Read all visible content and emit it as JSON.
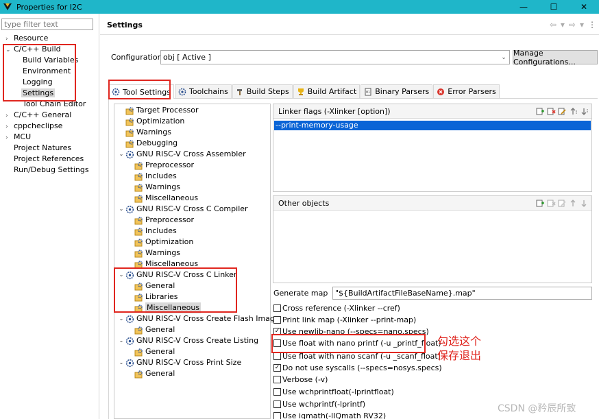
{
  "window": {
    "title": "Properties for I2C",
    "min": "—",
    "max": "☐",
    "close": "✕"
  },
  "filter": {
    "placeholder": "type filter text"
  },
  "nav": {
    "resource": "Resource",
    "cc_build": "C/C++ Build",
    "build_variables": "Build Variables",
    "environment": "Environment",
    "logging": "Logging",
    "settings": "Settings",
    "tool_chain_editor": "Tool Chain Editor",
    "cc_general": "C/C++ General",
    "cppcheclipse": "cppcheclipse",
    "mcu": "MCU",
    "project_natures": "Project Natures",
    "project_references": "Project References",
    "run_debug": "Run/Debug Settings"
  },
  "header": {
    "title": "Settings"
  },
  "config": {
    "label": "Configuration:",
    "value": "obj  [ Active ]",
    "manage": "Manage Configurations..."
  },
  "tabs": [
    "Tool Settings",
    "Toolchains",
    "Build Steps",
    "Build Artifact",
    "Binary Parsers",
    "Error Parsers"
  ],
  "tree": [
    "Target Processor",
    "Optimization",
    "Warnings",
    "Debugging",
    "GNU RISC-V Cross Assembler",
    "Preprocessor",
    "Includes",
    "Warnings",
    "Miscellaneous",
    "GNU RISC-V Cross C Compiler",
    "Preprocessor",
    "Includes",
    "Optimization",
    "Warnings",
    "Miscellaneous",
    "GNU RISC-V Cross C Linker",
    "General",
    "Libraries",
    "Miscellaneous",
    "GNU RISC-V Cross Create Flash Image",
    "General",
    "GNU RISC-V Cross Create Listing",
    "General",
    "GNU RISC-V Cross Print Size",
    "General"
  ],
  "linker_flags": {
    "title": "Linker flags (-Xlinker [option])",
    "item": "--print-memory-usage"
  },
  "other_objects": {
    "title": "Other objects"
  },
  "generate_map": {
    "label": "Generate map",
    "value": "\"${BuildArtifactFileBaseName}.map\""
  },
  "options": [
    {
      "label": "Cross reference (-Xlinker --cref)",
      "checked": false
    },
    {
      "label": "Print link map (-Xlinker --print-map)",
      "checked": false
    },
    {
      "label": "Use newlib-nano (--specs=nano.specs)",
      "checked": true
    },
    {
      "label": "Use float with nano printf (-u _printf_float)",
      "checked": false
    },
    {
      "label": "Use float with nano scanf (-u _scanf_float)",
      "checked": false
    },
    {
      "label": "Do not use syscalls (--specs=nosys.specs)",
      "checked": true
    },
    {
      "label": "Verbose (-v)",
      "checked": false
    },
    {
      "label": "Use wchprintfloat(-lprintfloat)",
      "checked": false
    },
    {
      "label": "Use wchprintf(-lprintf)",
      "checked": false
    },
    {
      "label": "Use iqmath(-lIQmath RV32)",
      "checked": false
    }
  ],
  "annotation": {
    "line1": "勾选这个",
    "line2": "保存退出"
  },
  "watermark": "CSDN @矜辰所致",
  "colors": {
    "titlebar": "#1fb6c9",
    "selection": "#0a64d6",
    "annotation": "#e0261f"
  }
}
